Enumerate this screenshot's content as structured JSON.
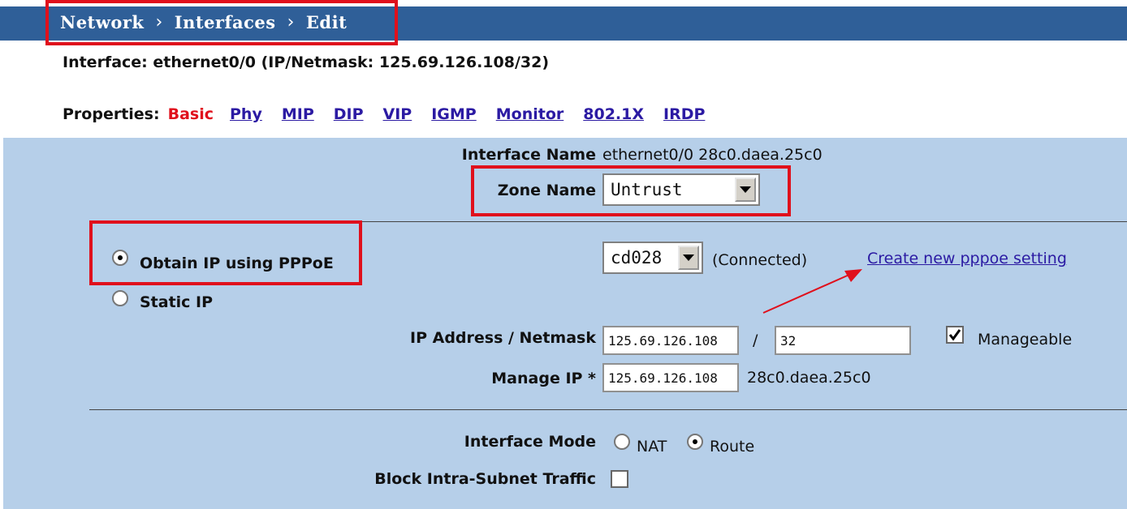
{
  "breadcrumb": {
    "items": [
      "Network",
      "Interfaces",
      "Edit"
    ],
    "separator": "›"
  },
  "interface_info": "Interface: ethernet0/0 (IP/Netmask: 125.69.126.108/32)",
  "properties": {
    "label": "Properties:",
    "active": "Basic",
    "links": [
      "Phy",
      "MIP",
      "DIP",
      "VIP",
      "IGMP",
      "Monitor",
      "802.1X",
      "IRDP"
    ]
  },
  "form": {
    "interface_name_label": "Interface Name",
    "interface_name_value": "ethernet0/0 28c0.daea.25c0",
    "zone_name_label": "Zone Name",
    "zone_name_value": "Untrust",
    "pppoe_label": "Obtain IP using PPPoE",
    "pppoe_selected": true,
    "pppoe_profile": "cd028",
    "pppoe_status": "(Connected)",
    "create_pppoe_link": "Create new pppoe setting",
    "static_ip_label": "Static IP",
    "ip_netmask_label": "IP Address / Netmask",
    "ip_address": "125.69.126.108",
    "slash": "/",
    "netmask": "32",
    "manageable_label": "Manageable",
    "manageable_checked": true,
    "manage_ip_label": "Manage IP *",
    "manage_ip": "125.69.126.108",
    "manage_mac": "28c0.daea.25c0",
    "interface_mode_label": "Interface Mode",
    "mode_nat": "NAT",
    "mode_route": "Route",
    "mode_selected": "Route",
    "block_intra_subnet_label": "Block Intra-Subnet Traffic",
    "block_intra_subnet_checked": false
  },
  "colors": {
    "header_bg": "#2f5f98",
    "panel_bg": "#b6cfe9",
    "highlight": "#e0101c",
    "link": "#2b1aa3"
  }
}
